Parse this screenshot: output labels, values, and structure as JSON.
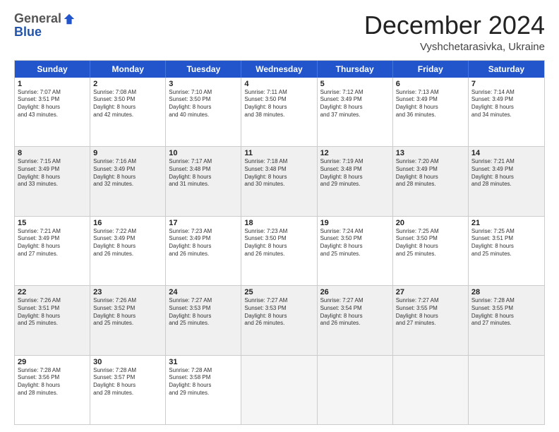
{
  "logo": {
    "general": "General",
    "blue": "Blue"
  },
  "title": "December 2024",
  "location": "Vyshchetarasivka, Ukraine",
  "days": [
    "Sunday",
    "Monday",
    "Tuesday",
    "Wednesday",
    "Thursday",
    "Friday",
    "Saturday"
  ],
  "weeks": [
    [
      {
        "day": "1",
        "lines": [
          "Sunrise: 7:07 AM",
          "Sunset: 3:51 PM",
          "Daylight: 8 hours",
          "and 43 minutes."
        ]
      },
      {
        "day": "2",
        "lines": [
          "Sunrise: 7:08 AM",
          "Sunset: 3:50 PM",
          "Daylight: 8 hours",
          "and 42 minutes."
        ]
      },
      {
        "day": "3",
        "lines": [
          "Sunrise: 7:10 AM",
          "Sunset: 3:50 PM",
          "Daylight: 8 hours",
          "and 40 minutes."
        ]
      },
      {
        "day": "4",
        "lines": [
          "Sunrise: 7:11 AM",
          "Sunset: 3:50 PM",
          "Daylight: 8 hours",
          "and 38 minutes."
        ]
      },
      {
        "day": "5",
        "lines": [
          "Sunrise: 7:12 AM",
          "Sunset: 3:49 PM",
          "Daylight: 8 hours",
          "and 37 minutes."
        ]
      },
      {
        "day": "6",
        "lines": [
          "Sunrise: 7:13 AM",
          "Sunset: 3:49 PM",
          "Daylight: 8 hours",
          "and 36 minutes."
        ]
      },
      {
        "day": "7",
        "lines": [
          "Sunrise: 7:14 AM",
          "Sunset: 3:49 PM",
          "Daylight: 8 hours",
          "and 34 minutes."
        ]
      }
    ],
    [
      {
        "day": "8",
        "lines": [
          "Sunrise: 7:15 AM",
          "Sunset: 3:49 PM",
          "Daylight: 8 hours",
          "and 33 minutes."
        ]
      },
      {
        "day": "9",
        "lines": [
          "Sunrise: 7:16 AM",
          "Sunset: 3:49 PM",
          "Daylight: 8 hours",
          "and 32 minutes."
        ]
      },
      {
        "day": "10",
        "lines": [
          "Sunrise: 7:17 AM",
          "Sunset: 3:48 PM",
          "Daylight: 8 hours",
          "and 31 minutes."
        ]
      },
      {
        "day": "11",
        "lines": [
          "Sunrise: 7:18 AM",
          "Sunset: 3:48 PM",
          "Daylight: 8 hours",
          "and 30 minutes."
        ]
      },
      {
        "day": "12",
        "lines": [
          "Sunrise: 7:19 AM",
          "Sunset: 3:48 PM",
          "Daylight: 8 hours",
          "and 29 minutes."
        ]
      },
      {
        "day": "13",
        "lines": [
          "Sunrise: 7:20 AM",
          "Sunset: 3:49 PM",
          "Daylight: 8 hours",
          "and 28 minutes."
        ]
      },
      {
        "day": "14",
        "lines": [
          "Sunrise: 7:21 AM",
          "Sunset: 3:49 PM",
          "Daylight: 8 hours",
          "and 28 minutes."
        ]
      }
    ],
    [
      {
        "day": "15",
        "lines": [
          "Sunrise: 7:21 AM",
          "Sunset: 3:49 PM",
          "Daylight: 8 hours",
          "and 27 minutes."
        ]
      },
      {
        "day": "16",
        "lines": [
          "Sunrise: 7:22 AM",
          "Sunset: 3:49 PM",
          "Daylight: 8 hours",
          "and 26 minutes."
        ]
      },
      {
        "day": "17",
        "lines": [
          "Sunrise: 7:23 AM",
          "Sunset: 3:49 PM",
          "Daylight: 8 hours",
          "and 26 minutes."
        ]
      },
      {
        "day": "18",
        "lines": [
          "Sunrise: 7:23 AM",
          "Sunset: 3:50 PM",
          "Daylight: 8 hours",
          "and 26 minutes."
        ]
      },
      {
        "day": "19",
        "lines": [
          "Sunrise: 7:24 AM",
          "Sunset: 3:50 PM",
          "Daylight: 8 hours",
          "and 25 minutes."
        ]
      },
      {
        "day": "20",
        "lines": [
          "Sunrise: 7:25 AM",
          "Sunset: 3:50 PM",
          "Daylight: 8 hours",
          "and 25 minutes."
        ]
      },
      {
        "day": "21",
        "lines": [
          "Sunrise: 7:25 AM",
          "Sunset: 3:51 PM",
          "Daylight: 8 hours",
          "and 25 minutes."
        ]
      }
    ],
    [
      {
        "day": "22",
        "lines": [
          "Sunrise: 7:26 AM",
          "Sunset: 3:51 PM",
          "Daylight: 8 hours",
          "and 25 minutes."
        ]
      },
      {
        "day": "23",
        "lines": [
          "Sunrise: 7:26 AM",
          "Sunset: 3:52 PM",
          "Daylight: 8 hours",
          "and 25 minutes."
        ]
      },
      {
        "day": "24",
        "lines": [
          "Sunrise: 7:27 AM",
          "Sunset: 3:53 PM",
          "Daylight: 8 hours",
          "and 25 minutes."
        ]
      },
      {
        "day": "25",
        "lines": [
          "Sunrise: 7:27 AM",
          "Sunset: 3:53 PM",
          "Daylight: 8 hours",
          "and 26 minutes."
        ]
      },
      {
        "day": "26",
        "lines": [
          "Sunrise: 7:27 AM",
          "Sunset: 3:54 PM",
          "Daylight: 8 hours",
          "and 26 minutes."
        ]
      },
      {
        "day": "27",
        "lines": [
          "Sunrise: 7:27 AM",
          "Sunset: 3:55 PM",
          "Daylight: 8 hours",
          "and 27 minutes."
        ]
      },
      {
        "day": "28",
        "lines": [
          "Sunrise: 7:28 AM",
          "Sunset: 3:55 PM",
          "Daylight: 8 hours",
          "and 27 minutes."
        ]
      }
    ],
    [
      {
        "day": "29",
        "lines": [
          "Sunrise: 7:28 AM",
          "Sunset: 3:56 PM",
          "Daylight: 8 hours",
          "and 28 minutes."
        ]
      },
      {
        "day": "30",
        "lines": [
          "Sunrise: 7:28 AM",
          "Sunset: 3:57 PM",
          "Daylight: 8 hours",
          "and 28 minutes."
        ]
      },
      {
        "day": "31",
        "lines": [
          "Sunrise: 7:28 AM",
          "Sunset: 3:58 PM",
          "Daylight: 8 hours",
          "and 29 minutes."
        ]
      },
      {
        "day": "",
        "lines": []
      },
      {
        "day": "",
        "lines": []
      },
      {
        "day": "",
        "lines": []
      },
      {
        "day": "",
        "lines": []
      }
    ]
  ]
}
